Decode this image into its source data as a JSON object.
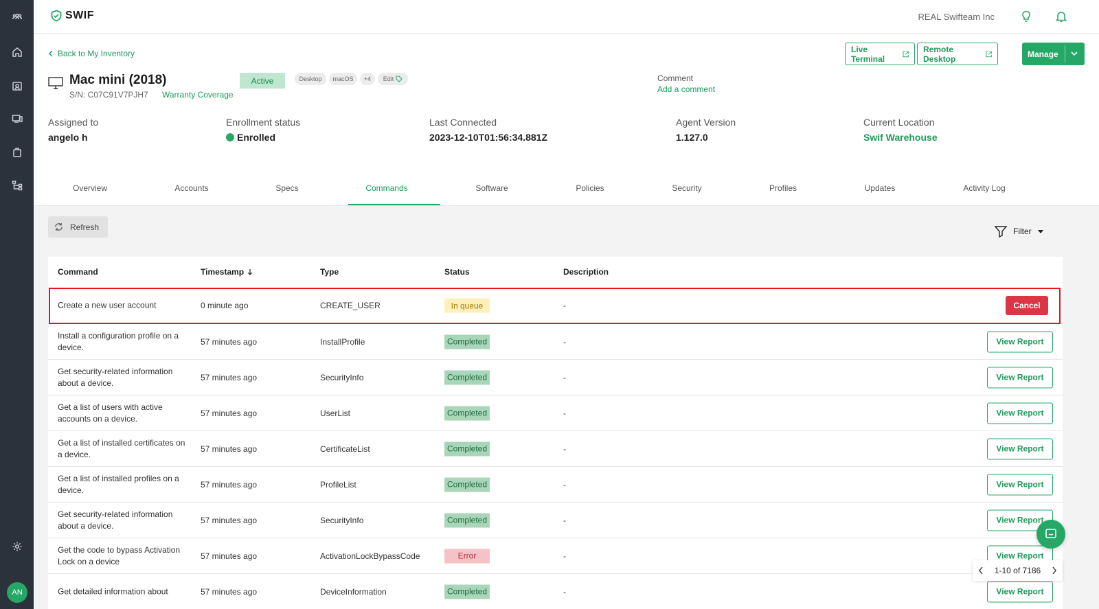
{
  "brand": {
    "logo_text": "SWIF"
  },
  "topbar": {
    "org_name": "REAL Swifteam Inc"
  },
  "header": {
    "back_link": "Back to My Inventory",
    "buttons": {
      "live_terminal": "Live Terminal",
      "remote_desktop": "Remote Desktop",
      "manage": "Manage"
    },
    "device_name": "Mac mini (2018)",
    "serial": "S/N: C07C91V7PJH7",
    "warranty": "Warranty Coverage",
    "status_badge": "Active",
    "tags": [
      "Desktop",
      "macOS",
      "+4",
      "Edit"
    ],
    "comment_label": "Comment",
    "comment_link": "Add a comment"
  },
  "info": {
    "assigned_label": "Assigned to",
    "assigned_value": "angelo h",
    "enroll_label": "Enrollment status",
    "enroll_value": "Enrolled",
    "last_label": "Last Connected",
    "last_value": "2023-12-10T01:56:34.881Z",
    "agent_label": "Agent Version",
    "agent_value": "1.127.0",
    "location_label": "Current Location",
    "location_value": "Swif Warehouse"
  },
  "tabs": [
    "Overview",
    "Accounts",
    "Specs",
    "Commands",
    "Software",
    "Policies",
    "Security",
    "Profiles",
    "Updates",
    "Activity Log"
  ],
  "active_tab": "Commands",
  "toolbar": {
    "refresh": "Refresh",
    "filter": "Filter"
  },
  "table": {
    "headers": {
      "command": "Command",
      "timestamp": "Timestamp",
      "type": "Type",
      "status": "Status",
      "description": "Description"
    },
    "rows": [
      {
        "command": "Create a new user account",
        "timestamp": "0 minute ago",
        "type": "CREATE_USER",
        "status": "In queue",
        "description": "-",
        "action": "Cancel"
      },
      {
        "command": "Install a configuration profile on a device.",
        "timestamp": "57 minutes ago",
        "type": "InstallProfile",
        "status": "Completed",
        "description": "-",
        "action": "View Report"
      },
      {
        "command": "Get security-related information about a device.",
        "timestamp": "57 minutes ago",
        "type": "SecurityInfo",
        "status": "Completed",
        "description": "-",
        "action": "View Report"
      },
      {
        "command": "Get a list of users with active accounts on a device.",
        "timestamp": "57 minutes ago",
        "type": "UserList",
        "status": "Completed",
        "description": "-",
        "action": "View Report"
      },
      {
        "command": "Get a list of installed certificates on a device.",
        "timestamp": "57 minutes ago",
        "type": "CertificateList",
        "status": "Completed",
        "description": "-",
        "action": "View Report"
      },
      {
        "command": "Get a list of installed profiles on a device.",
        "timestamp": "57 minutes ago",
        "type": "ProfileList",
        "status": "Completed",
        "description": "-",
        "action": "View Report"
      },
      {
        "command": "Get security-related information about a device.",
        "timestamp": "57 minutes ago",
        "type": "SecurityInfo",
        "status": "Completed",
        "description": "-",
        "action": "View Report"
      },
      {
        "command": "Get the code to bypass Activation Lock on a device",
        "timestamp": "57 minutes ago",
        "type": "ActivationLockBypassCode",
        "status": "Error",
        "description": "-",
        "action": "View Report"
      },
      {
        "command": "Get detailed information about",
        "timestamp": "57 minutes ago",
        "type": "DeviceInformation",
        "status": "Completed",
        "description": "-",
        "action": "View Report"
      }
    ]
  },
  "pager": {
    "range": "1-10 of 7186"
  },
  "user": {
    "initials": "AN"
  },
  "colors": {
    "accent": "#25a866",
    "danger": "#dc3545",
    "sidebar": "#2b323b"
  }
}
